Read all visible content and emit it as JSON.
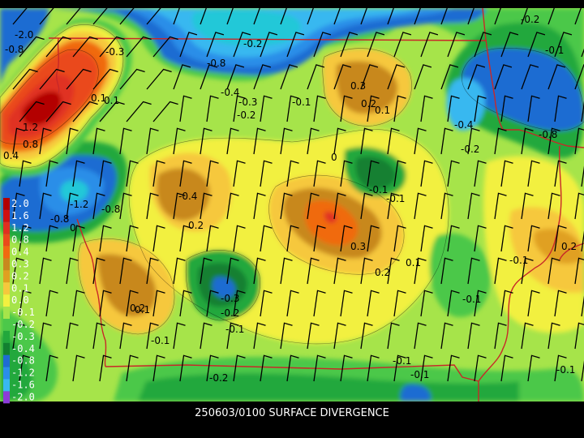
{
  "caption": "250603/0100 SURFACE DIVERGENCE",
  "legend": [
    {
      "label": "2.0",
      "color": "#b30000"
    },
    {
      "label": "1.6",
      "color": "#d01010"
    },
    {
      "label": "1.2",
      "color": "#e03020"
    },
    {
      "label": "0.8",
      "color": "#ea4a1a"
    },
    {
      "label": "0.4",
      "color": "#f06a10"
    },
    {
      "label": "0.3",
      "color": "#c8881e"
    },
    {
      "label": "0.2",
      "color": "#e0a020"
    },
    {
      "label": "0.1",
      "color": "#f6c83c"
    },
    {
      "label": "0.0",
      "color": "#f2f040"
    },
    {
      "label": "-0.1",
      "color": "#a6e44a"
    },
    {
      "label": "-0.2",
      "color": "#4cc84a"
    },
    {
      "label": "-0.3",
      "color": "#22a83c"
    },
    {
      "label": "-0.4",
      "color": "#128030"
    },
    {
      "label": "-0.8",
      "color": "#1e6cd2"
    },
    {
      "label": "-1.2",
      "color": "#2a8ee8"
    },
    {
      "label": "-1.6",
      "color": "#38b8f0"
    },
    {
      "label": "-2.0",
      "color": "#8c3cd8"
    }
  ],
  "map_labels": [
    {
      "text": "-2.0"
    },
    {
      "text": "-0.8"
    },
    {
      "text": "-0.3"
    },
    {
      "text": "-0.2"
    },
    {
      "text": "-0.8"
    },
    {
      "text": "-0.4"
    },
    {
      "text": "-0.3"
    },
    {
      "text": "-0.2"
    },
    {
      "text": "-0.1"
    },
    {
      "text": "0.1"
    },
    {
      "text": "0.1"
    },
    {
      "text": "0.3"
    },
    {
      "text": "0.2"
    },
    {
      "text": "0.1"
    },
    {
      "text": "-0.4"
    },
    {
      "text": "-0.2"
    },
    {
      "text": "-0.8"
    },
    {
      "text": "-0.1"
    },
    {
      "text": "-0.2"
    },
    {
      "text": "-0.1"
    },
    {
      "text": "1.2"
    },
    {
      "text": "0.8"
    },
    {
      "text": "0.4"
    },
    {
      "text": "0"
    },
    {
      "text": "-0.1"
    },
    {
      "text": "-1.2"
    },
    {
      "text": "-0.8"
    },
    {
      "text": "-0.8"
    },
    {
      "text": "-0.4"
    },
    {
      "text": "0.2"
    },
    {
      "text": "0.3"
    },
    {
      "text": "0.2"
    },
    {
      "text": "0.1"
    },
    {
      "text": "-0.1"
    },
    {
      "text": "0.2"
    },
    {
      "text": "-0.1"
    },
    {
      "text": "-0.3"
    },
    {
      "text": "-0.2"
    },
    {
      "text": "-0.1"
    },
    {
      "text": "-0.1"
    },
    {
      "text": "0.1"
    },
    {
      "text": "0.2"
    },
    {
      "text": "-0.1"
    },
    {
      "text": "-0.1"
    },
    {
      "text": "-0.2"
    },
    {
      "text": "-0.1"
    },
    {
      "text": "0"
    }
  ],
  "colors": {
    "background": "#000000",
    "border_line": "#c82828",
    "barb": "#000000",
    "label_text": "#000000",
    "legend_text": "#ffffff"
  }
}
